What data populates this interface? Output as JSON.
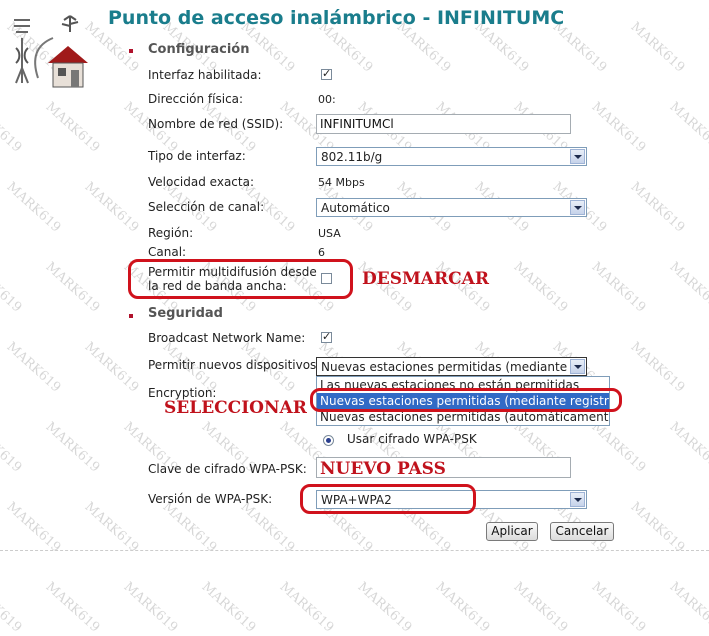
{
  "page": {
    "title": "Punto de acceso inalámbrico - INFINITUMC"
  },
  "config": {
    "heading": "Configuración",
    "interface_enabled_label": "Interfaz habilitada:",
    "interface_enabled": true,
    "mac_label": "Dirección física:",
    "mac_value": "00:",
    "ssid_label": "Nombre de red (SSID):",
    "ssid_value": "INFINITUMCl",
    "iftype_label": "Tipo de interfaz:",
    "iftype_value": "802.11b/g",
    "speed_label": "Velocidad exacta:",
    "speed_value": "54 Mbps",
    "channel_sel_label": "Selección de canal:",
    "channel_sel_value": "Automático",
    "region_label": "Región:",
    "region_value": "USA",
    "channel_label": "Canal:",
    "channel_value": "6",
    "multicast_label_line1": "Permitir multidifusión desde",
    "multicast_label_line2": "la red de banda ancha:",
    "multicast_checked": false
  },
  "security": {
    "heading": "Seguridad",
    "broadcast_label": "Broadcast Network Name:",
    "broadcast_checked": true,
    "new_devices_label": "Permitir nuevos dispositivos:",
    "new_devices_value": "Nuevas estaciones permitidas (mediante r",
    "new_devices_options": [
      "Las nuevas estaciones no están permitidas",
      "Nuevas estaciones permitidas (mediante registro)",
      "Nuevas estaciones permitidas (automáticamente)"
    ],
    "new_devices_selected_index": 1,
    "encryption_label": "Encryption:",
    "wpa_radio_label": "Usar cifrado WPA-PSK",
    "wpa_key_label": "Clave de cifrado WPA-PSK:",
    "wpa_version_label": "Versión de WPA-PSK:",
    "wpa_version_value": "WPA+WPA2"
  },
  "buttons": {
    "apply": "Aplicar",
    "cancel": "Cancelar"
  },
  "annotations": {
    "uncheck": "DESMARCAR",
    "select": "SELECCIONAR",
    "new_pass": "NUEVO PASS",
    "color": "#c0121c"
  },
  "watermark": "MARK619",
  "colors": {
    "title": "#1a7d8c",
    "bullet": "#b0122c",
    "highlight": "#316ac5"
  }
}
